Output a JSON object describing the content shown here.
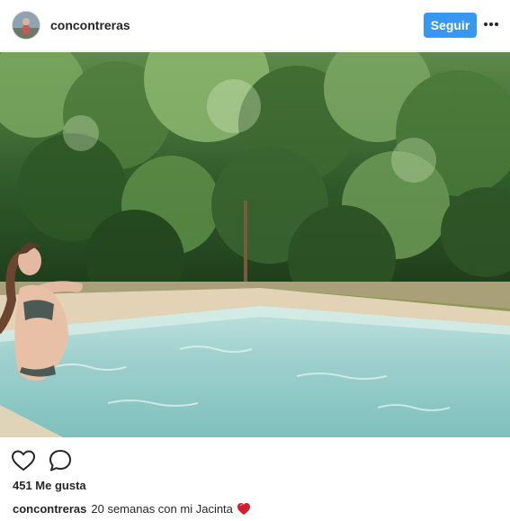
{
  "post": {
    "username": "concontreras",
    "follow_label": "Seguir",
    "likes_text": "451 Me gusta",
    "caption": {
      "username": "concontreras",
      "text": "20 semanas con mi Jacinta"
    },
    "icons": {
      "more": "more-options-icon",
      "like": "heart-outline-icon",
      "comment": "comment-bubble-icon",
      "caption_emoji": "red-heart-emoji"
    },
    "colors": {
      "accent": "#3897f0",
      "text": "#262626",
      "emoji_heart": "#d21f2b"
    }
  }
}
